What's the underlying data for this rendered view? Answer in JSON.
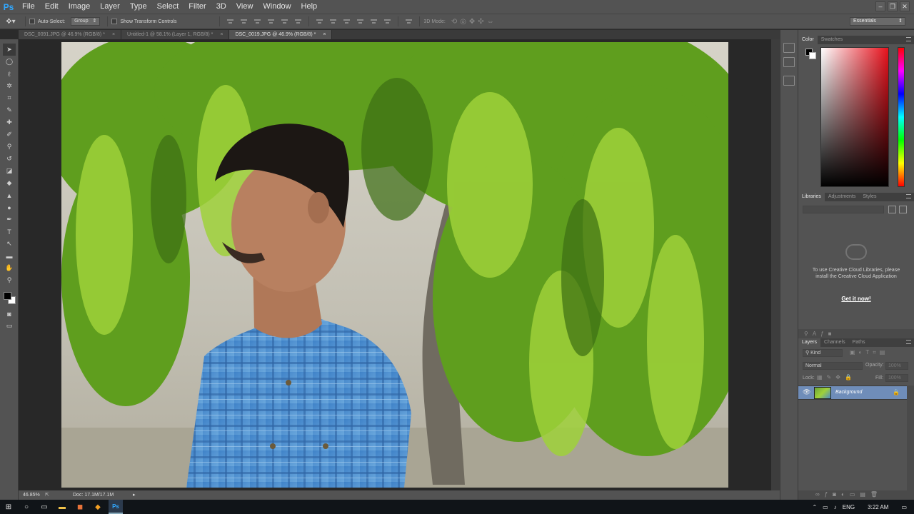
{
  "app": {
    "logo": "Ps",
    "menu": [
      "File",
      "Edit",
      "Image",
      "Layer",
      "Type",
      "Select",
      "Filter",
      "3D",
      "View",
      "Window",
      "Help"
    ]
  },
  "options_bar": {
    "auto_select_label": "Auto-Select:",
    "auto_select_value": "Group",
    "show_transform_label": "Show Transform Controls",
    "mode_3d_label": "3D Mode:",
    "workspace": "Essentials"
  },
  "tabs": [
    {
      "label": "DSC_0091.JPG @ 46.9% (RGB/8) *"
    },
    {
      "label": "Untitled-1 @ 58.1% (Layer 1, RGB/8) *"
    },
    {
      "label": "DSC_0019.JPG @ 46.9% (RGB/8) *"
    }
  ],
  "status": {
    "zoom": "46.85%",
    "doc": "Doc: 17.1M/17.1M"
  },
  "color_panel": {
    "tabs": [
      "Color",
      "Swatches"
    ]
  },
  "libraries_panel": {
    "tabs": [
      "Libraries",
      "Adjustments",
      "Styles"
    ],
    "message": "To use Creative Cloud Libraries, please install the Creative Cloud Application",
    "cta": "Get it now!"
  },
  "layers_panel": {
    "tabs": [
      "Layers",
      "Channels",
      "Paths"
    ],
    "kind_filter": "Kind",
    "blend_mode": "Normal",
    "opacity_label": "Opacity:",
    "opacity_value": "100%",
    "lock_label": "Lock:",
    "fill_label": "Fill:",
    "fill_value": "100%",
    "layers": [
      {
        "name": "Background"
      }
    ]
  },
  "taskbar": {
    "language": "ENG",
    "time": "3:22 AM"
  },
  "colors": {
    "ps_blue": "#31a8ff",
    "chrome": "#535353",
    "canvas_bg": "#282828",
    "layer_selected": "#6f8db9"
  }
}
